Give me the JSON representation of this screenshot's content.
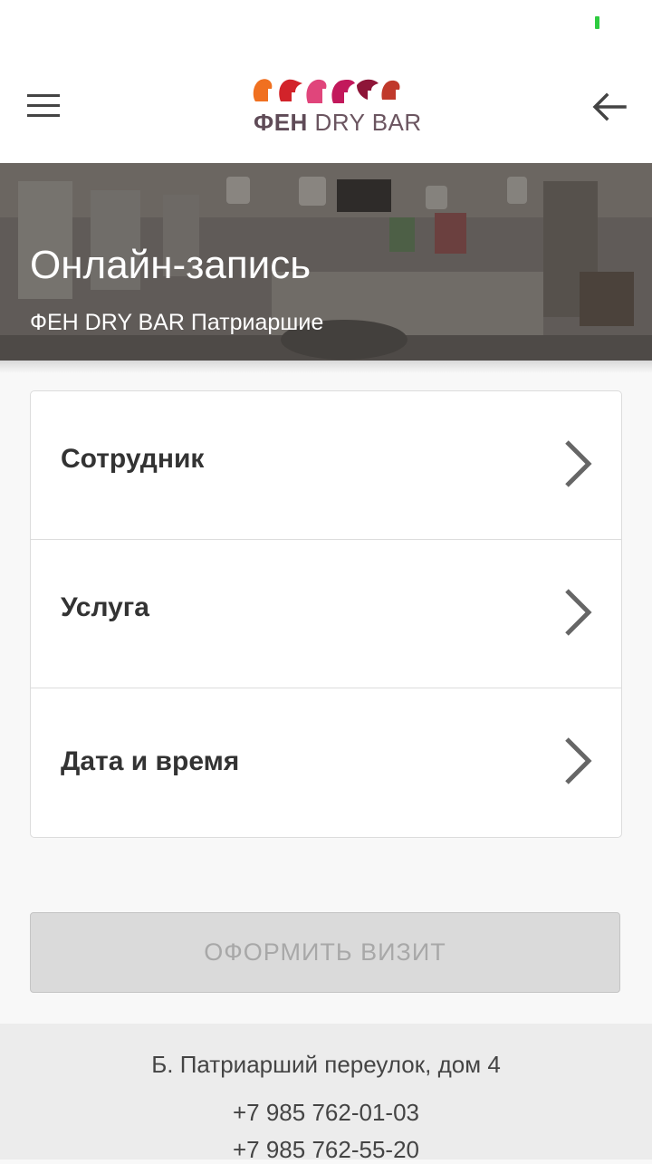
{
  "header": {
    "logo_brand_bold": "ФЕН",
    "logo_brand_rest": " DRY BAR"
  },
  "hero": {
    "title": "Онлайн-запись",
    "subtitle": "ФЕН DRY BAR Патриаршие"
  },
  "booking": {
    "rows": [
      {
        "label": "Сотрудник"
      },
      {
        "label": "Услуга"
      },
      {
        "label": "Дата и время"
      }
    ],
    "submit_label": "ОФОРМИТЬ ВИЗИТ",
    "submit_enabled": false
  },
  "footer": {
    "address": "Б. Патриарший переулок, дом 4",
    "phones": [
      "+7 985 762-01-03",
      "+7 985 762-55-20"
    ]
  },
  "colors": {
    "battery": "#2ecc40",
    "logo_text": "#6b5560",
    "logo_heads": [
      "#f07020",
      "#d2232a",
      "#e0457b",
      "#c2185b",
      "#8e1538",
      "#c0392b"
    ],
    "disabled_button": "#dadada"
  },
  "icons": {
    "menu": "hamburger-menu-icon",
    "back": "arrow-left-icon",
    "row_arrow": "chevron-right-icon"
  }
}
